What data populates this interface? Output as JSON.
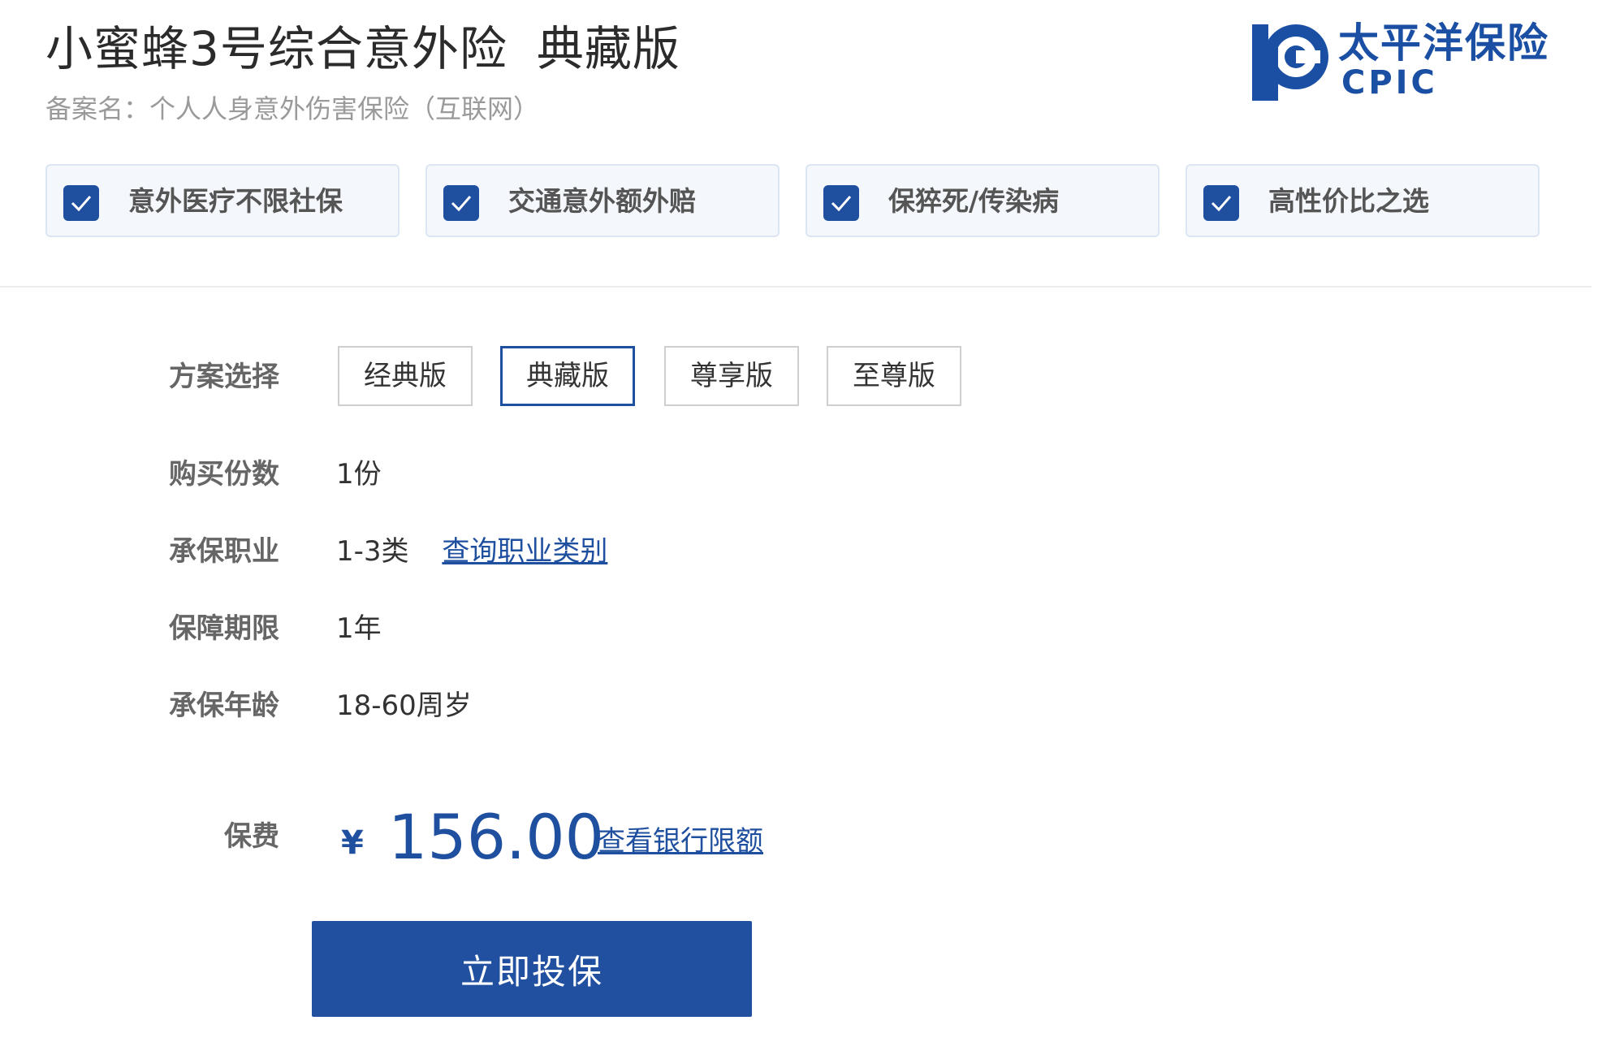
{
  "header": {
    "title": "小蜜蜂3号综合意外险",
    "edition": "典藏版",
    "filing_name": "备案名：个人人身意外伤害保险（互联网）"
  },
  "logo": {
    "name_cn": "太平洋保险",
    "name_en": "CPIC"
  },
  "features": [
    {
      "label": "意外医疗不限社保",
      "icon": "checkbox-checked-icon"
    },
    {
      "label": "交通意外额外赔",
      "icon": "checkbox-checked-icon"
    },
    {
      "label": "保猝死/传染病",
      "icon": "checkbox-checked-icon"
    },
    {
      "label": "高性价比之选",
      "icon": "checkbox-checked-icon"
    }
  ],
  "form": {
    "plan_label": "方案选择",
    "plans": [
      {
        "label": "经典版",
        "selected": false
      },
      {
        "label": "典藏版",
        "selected": true
      },
      {
        "label": "尊享版",
        "selected": false
      },
      {
        "label": "至尊版",
        "selected": false
      }
    ],
    "quantity_label": "购买份数",
    "quantity_value": "1份",
    "occupation_label": "承保职业",
    "occupation_value": "1-3类",
    "occupation_link": "查询职业类别",
    "term_label": "保障期限",
    "term_value": "1年",
    "age_label": "承保年龄",
    "age_value": "18-60周岁"
  },
  "premium": {
    "label": "保费",
    "currency": "¥",
    "amount": "156.00",
    "bank_link": "查看银行限额"
  },
  "buy_button": "立即投保",
  "colors": {
    "brand_blue": "#1f4f9f",
    "button_blue": "#2150a0",
    "badge_bg": "#f4f7fc"
  }
}
